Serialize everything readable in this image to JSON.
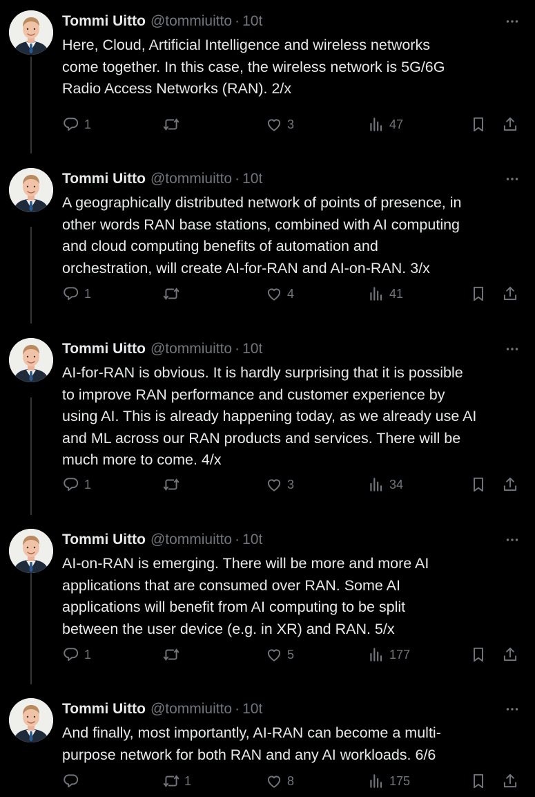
{
  "tweets": [
    {
      "author": {
        "name": "Tommi Uitto",
        "handle": "@tommiuitto",
        "separator": "·",
        "time": "10t"
      },
      "text_lines": [
        "Here, Cloud, Artificial Intelligence and wireless networks",
        "come together. In this case, the wireless network is 5G/6G",
        "Radio Access Networks (RAN). 2/x"
      ],
      "stats": {
        "replies": "1",
        "retweets": "",
        "likes": "3",
        "views": "47"
      }
    },
    {
      "author": {
        "name": "Tommi Uitto",
        "handle": "@tommiuitto",
        "separator": "·",
        "time": "10t"
      },
      "text_lines": [
        "A geographically distributed network of points of presence, in",
        "other words RAN base stations, combined with AI computing",
        "and cloud computing benefits of automation and",
        "orchestration, will create AI-for-RAN and AI-on-RAN. 3/x"
      ],
      "stats": {
        "replies": "1",
        "retweets": "",
        "likes": "4",
        "views": "41"
      }
    },
    {
      "author": {
        "name": "Tommi Uitto",
        "handle": "@tommiuitto",
        "separator": "·",
        "time": "10t"
      },
      "text_lines": [
        "AI-for-RAN is obvious. It is hardly surprising that it is possible",
        "to improve RAN performance and customer experience by",
        "using AI. This is already happening today, as we already use AI",
        "and ML across our RAN products and services. There will be",
        "much more to come. 4/x"
      ],
      "stats": {
        "replies": "1",
        "retweets": "",
        "likes": "3",
        "views": "34"
      }
    },
    {
      "author": {
        "name": "Tommi Uitto",
        "handle": "@tommiuitto",
        "separator": "·",
        "time": "10t"
      },
      "text_lines": [
        "AI-on-RAN is emerging. There will be more and more AI",
        "applications that are consumed over RAN. Some AI",
        "applications will benefit from AI computing to be split",
        "between the user device (e.g. in XR) and RAN. 5/x"
      ],
      "stats": {
        "replies": "1",
        "retweets": "",
        "likes": "5",
        "views": "177"
      }
    },
    {
      "author": {
        "name": "Tommi Uitto",
        "handle": "@tommiuitto",
        "separator": "·",
        "time": "10t"
      },
      "text_lines": [
        "And finally, most importantly, AI-RAN can become a multi-",
        "purpose network for both RAN and any AI workloads. 6/6"
      ],
      "stats": {
        "replies": "",
        "retweets": "1",
        "likes": "8",
        "views": "175"
      }
    }
  ],
  "icons": {
    "reply": "reply-icon",
    "retweet": "retweet-icon",
    "like": "heart-icon",
    "views": "views-chart-icon",
    "bookmark": "bookmark-icon",
    "share": "share-icon",
    "more": "more-dots-icon"
  },
  "colors": {
    "background": "#000000",
    "text": "#e7e9ea",
    "muted": "#71767b",
    "thread_line": "#333639"
  }
}
